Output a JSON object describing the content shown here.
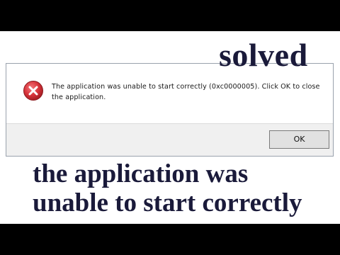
{
  "dialog": {
    "message": "The application was unable to start correctly (0xc0000005). Click OK to close the application.",
    "ok_label": "OK",
    "icon": "error-icon",
    "icon_color": "#d7333a"
  },
  "overlay": {
    "solved_text": "solved",
    "headline_line1": "the application was",
    "headline_line2": "unable to start correctly",
    "text_color": "#1a1a3a"
  }
}
